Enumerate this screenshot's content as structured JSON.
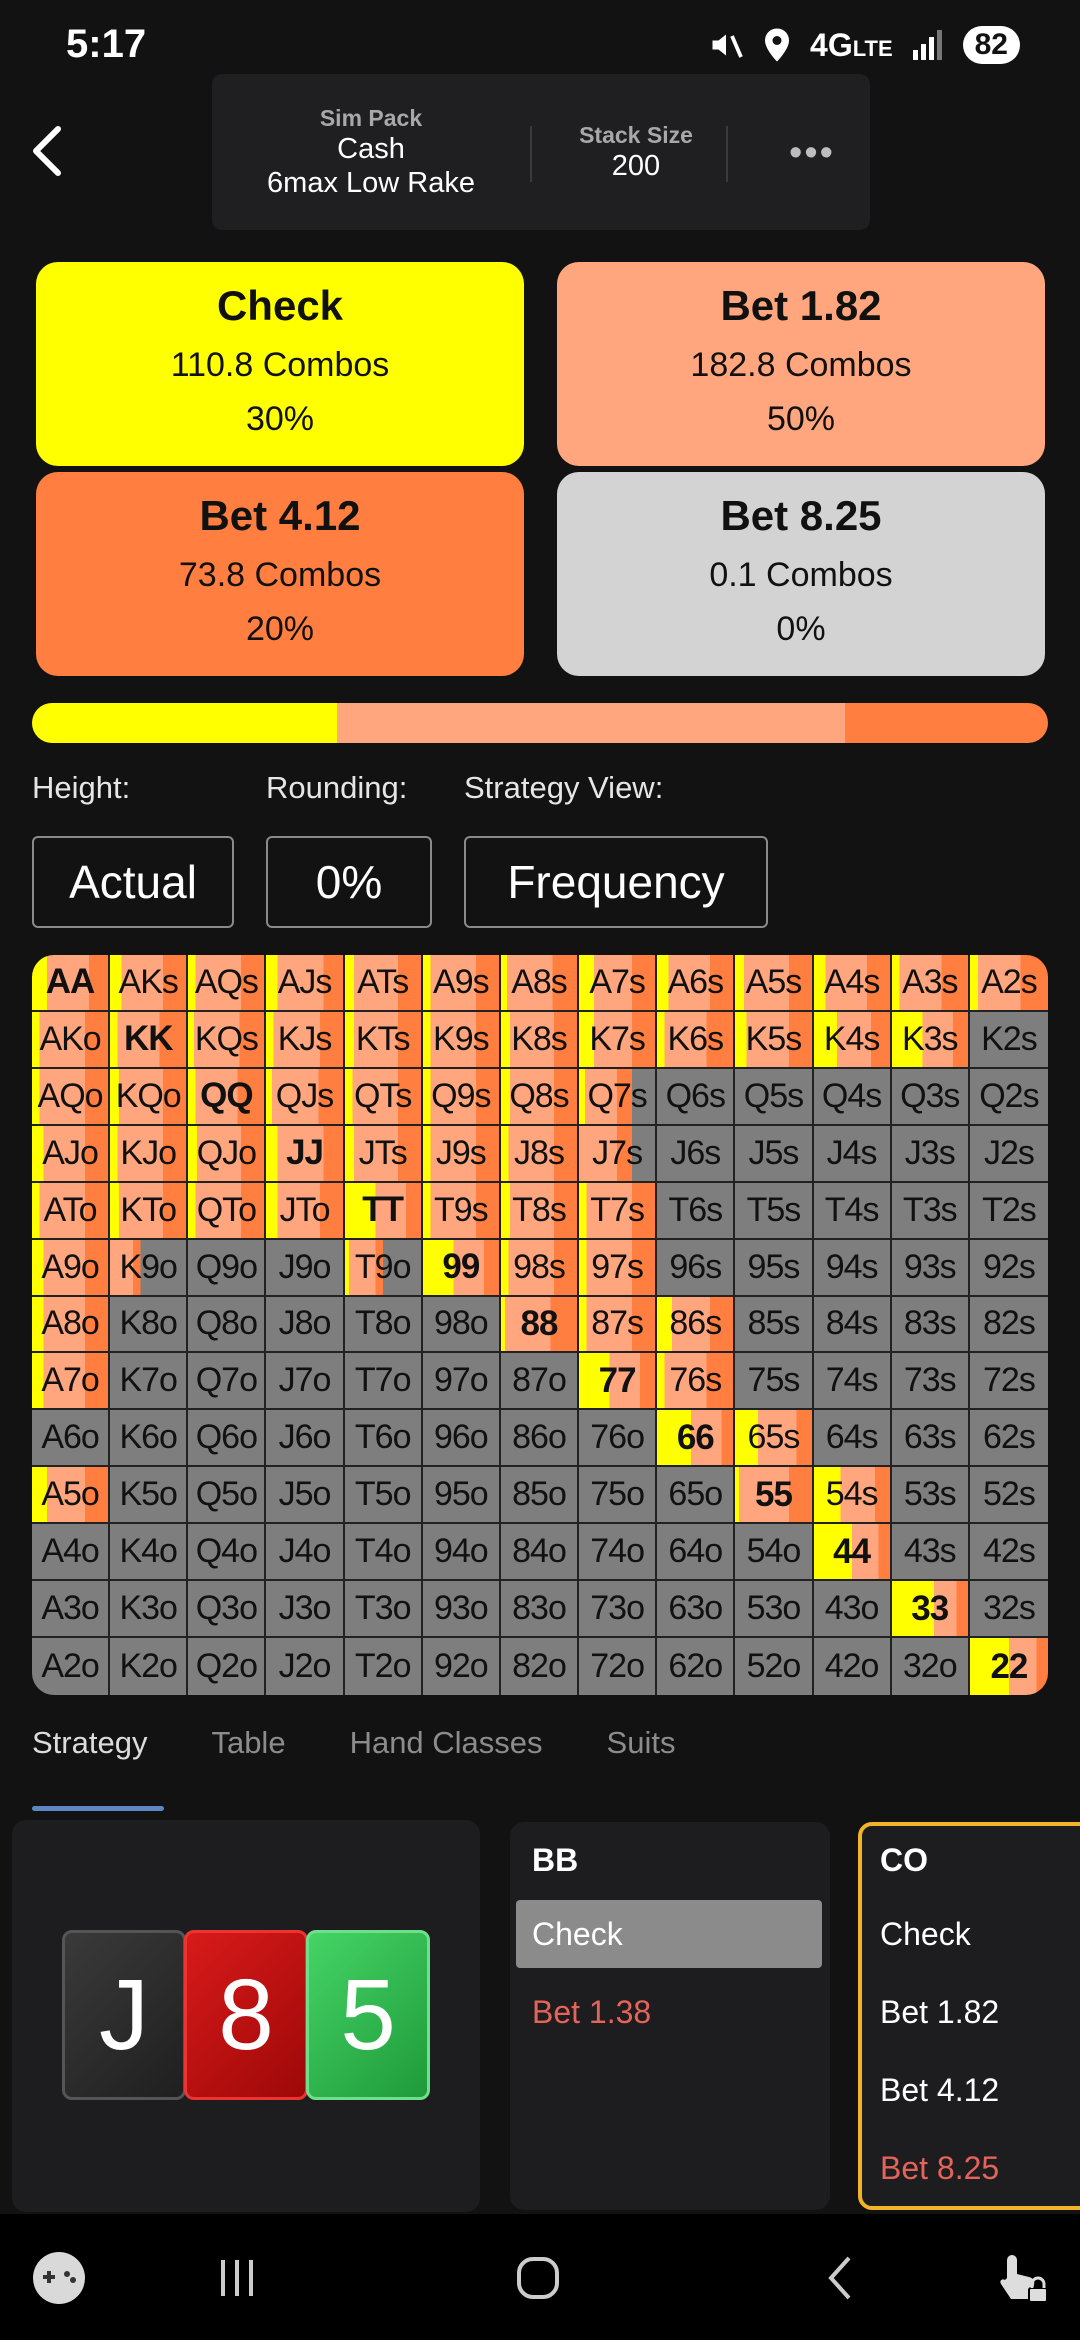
{
  "status": {
    "time": "5:17",
    "network": "4G",
    "lte": "LTE",
    "battery": "82"
  },
  "header": {
    "sim_pack_label": "Sim Pack",
    "sim_pack_line1": "Cash",
    "sim_pack_line2": "6max Low Rake",
    "stack_label": "Stack Size",
    "stack_value": "200",
    "more": "•••"
  },
  "actions": [
    {
      "title": "Check",
      "combos": "110.8 Combos",
      "pct": "30%",
      "color": "#ffff00",
      "share": 0.3
    },
    {
      "title": "Bet 1.82",
      "combos": "182.8 Combos",
      "pct": "50%",
      "color": "#ffa67e",
      "share": 0.5
    },
    {
      "title": "Bet 4.12",
      "combos": "73.8 Combos",
      "pct": "20%",
      "color": "#ff7e40",
      "share": 0.2
    },
    {
      "title": "Bet 8.25",
      "combos": "0.1 Combos",
      "pct": "0%",
      "color": "#d3d3d3",
      "share": 0.0
    }
  ],
  "settings": {
    "height_label": "Height:",
    "height_value": "Actual",
    "rounding_label": "Rounding:",
    "rounding_value": "0%",
    "view_label": "Strategy View:",
    "view_value": "Frequency"
  },
  "grid": {
    "rows": [
      [
        "AA",
        "AKs",
        "AQs",
        "AJs",
        "ATs",
        "A9s",
        "A8s",
        "A7s",
        "A6s",
        "A5s",
        "A4s",
        "A3s",
        "A2s"
      ],
      [
        "AKo",
        "KK",
        "KQs",
        "KJs",
        "KTs",
        "K9s",
        "K8s",
        "K7s",
        "K6s",
        "K5s",
        "K4s",
        "K3s",
        "K2s"
      ],
      [
        "AQo",
        "KQo",
        "QQ",
        "QJs",
        "QTs",
        "Q9s",
        "Q8s",
        "Q7s",
        "Q6s",
        "Q5s",
        "Q4s",
        "Q3s",
        "Q2s"
      ],
      [
        "AJo",
        "KJo",
        "QJo",
        "JJ",
        "JTs",
        "J9s",
        "J8s",
        "J7s",
        "J6s",
        "J5s",
        "J4s",
        "J3s",
        "J2s"
      ],
      [
        "ATo",
        "KTo",
        "QTo",
        "JTo",
        "TT",
        "T9s",
        "T8s",
        "T7s",
        "T6s",
        "T5s",
        "T4s",
        "T3s",
        "T2s"
      ],
      [
        "A9o",
        "K9o",
        "Q9o",
        "J9o",
        "T9o",
        "99",
        "98s",
        "97s",
        "96s",
        "95s",
        "94s",
        "93s",
        "92s"
      ],
      [
        "A8o",
        "K8o",
        "Q8o",
        "J8o",
        "T8o",
        "98o",
        "88",
        "87s",
        "86s",
        "85s",
        "84s",
        "83s",
        "82s"
      ],
      [
        "A7o",
        "K7o",
        "Q7o",
        "J7o",
        "T7o",
        "97o",
        "87o",
        "77",
        "76s",
        "75s",
        "74s",
        "73s",
        "72s"
      ],
      [
        "A6o",
        "K6o",
        "Q6o",
        "J6o",
        "T6o",
        "96o",
        "86o",
        "76o",
        "66",
        "65s",
        "64s",
        "63s",
        "62s"
      ],
      [
        "A5o",
        "K5o",
        "Q5o",
        "J5o",
        "T5o",
        "95o",
        "85o",
        "75o",
        "65o",
        "55",
        "54s",
        "53s",
        "52s"
      ],
      [
        "A4o",
        "K4o",
        "Q4o",
        "J4o",
        "T4o",
        "94o",
        "84o",
        "74o",
        "64o",
        "54o",
        "44",
        "43s",
        "42s"
      ],
      [
        "A3o",
        "K3o",
        "Q3o",
        "J3o",
        "T3o",
        "93o",
        "83o",
        "73o",
        "63o",
        "53o",
        "43o",
        "33",
        "32s"
      ],
      [
        "A2o",
        "K2o",
        "Q2o",
        "J2o",
        "T2o",
        "92o",
        "82o",
        "72o",
        "62o",
        "52o",
        "42o",
        "32o",
        "22"
      ]
    ],
    "frequencies": [
      [
        [
          0.2,
          0.55,
          0.25
        ],
        [
          0.15,
          0.55,
          0.3
        ],
        [
          0.1,
          0.6,
          0.3
        ],
        [
          0.15,
          0.6,
          0.25
        ],
        [
          0.12,
          0.58,
          0.3
        ],
        [
          0.1,
          0.6,
          0.3
        ],
        [
          0.08,
          0.6,
          0.32
        ],
        [
          0.2,
          0.5,
          0.3
        ],
        [
          0.15,
          0.55,
          0.3
        ],
        [
          0.12,
          0.58,
          0.3
        ],
        [
          0.15,
          0.55,
          0.3
        ],
        [
          0.1,
          0.55,
          0.35
        ],
        [
          0.1,
          0.55,
          0.35
        ]
      ],
      [
        [
          0.1,
          0.6,
          0.3
        ],
        [
          0.1,
          0.55,
          0.35
        ],
        [
          0.08,
          0.6,
          0.32
        ],
        [
          0.1,
          0.6,
          0.3
        ],
        [
          0.12,
          0.58,
          0.3
        ],
        [
          0.1,
          0.6,
          0.3
        ],
        [
          0.12,
          0.58,
          0.3
        ],
        [
          0.2,
          0.5,
          0.3
        ],
        [
          0.1,
          0.55,
          0.35
        ],
        [
          0.15,
          0.55,
          0.3
        ],
        [
          0.3,
          0.45,
          0.25
        ],
        [
          0.4,
          0.4,
          0.2
        ],
        [
          0.0,
          0.0,
          0.0
        ]
      ],
      [
        [
          0.1,
          0.6,
          0.3
        ],
        [
          0.12,
          0.58,
          0.3
        ],
        [
          0.1,
          0.55,
          0.35
        ],
        [
          0.08,
          0.6,
          0.32
        ],
        [
          0.1,
          0.6,
          0.3
        ],
        [
          0.1,
          0.6,
          0.3
        ],
        [
          0.12,
          0.58,
          0.3
        ],
        [
          0.08,
          0.42,
          0.2
        ],
        [
          0.0,
          0.0,
          0.0
        ],
        [
          0.0,
          0.0,
          0.0
        ],
        [
          0.0,
          0.0,
          0.0
        ],
        [
          0.0,
          0.0,
          0.0
        ],
        [
          0.0,
          0.0,
          0.0
        ]
      ],
      [
        [
          0.15,
          0.55,
          0.3
        ],
        [
          0.1,
          0.6,
          0.3
        ],
        [
          0.12,
          0.58,
          0.3
        ],
        [
          0.15,
          0.6,
          0.25
        ],
        [
          0.12,
          0.58,
          0.3
        ],
        [
          0.1,
          0.6,
          0.3
        ],
        [
          0.1,
          0.6,
          0.3
        ],
        [
          0.0,
          0.5,
          0.2
        ],
        [
          0.0,
          0.0,
          0.0
        ],
        [
          0.0,
          0.0,
          0.0
        ],
        [
          0.0,
          0.0,
          0.0
        ],
        [
          0.0,
          0.0,
          0.0
        ],
        [
          0.0,
          0.0,
          0.0
        ]
      ],
      [
        [
          0.1,
          0.6,
          0.3
        ],
        [
          0.12,
          0.58,
          0.3
        ],
        [
          0.1,
          0.6,
          0.3
        ],
        [
          0.15,
          0.55,
          0.3
        ],
        [
          0.4,
          0.4,
          0.2
        ],
        [
          0.1,
          0.6,
          0.3
        ],
        [
          0.12,
          0.58,
          0.3
        ],
        [
          0.1,
          0.6,
          0.3
        ],
        [
          0.0,
          0.0,
          0.0
        ],
        [
          0.0,
          0.0,
          0.0
        ],
        [
          0.0,
          0.0,
          0.0
        ],
        [
          0.0,
          0.0,
          0.0
        ],
        [
          0.0,
          0.0,
          0.0
        ]
      ],
      [
        [
          0.15,
          0.55,
          0.3
        ],
        [
          0.0,
          0.3,
          0.1
        ],
        [
          0.0,
          0.0,
          0.0
        ],
        [
          0.0,
          0.0,
          0.0
        ],
        [
          0.05,
          0.35,
          0.1
        ],
        [
          0.4,
          0.4,
          0.2
        ],
        [
          0.1,
          0.6,
          0.3
        ],
        [
          0.1,
          0.6,
          0.3
        ],
        [
          0.0,
          0.0,
          0.0
        ],
        [
          0.0,
          0.0,
          0.0
        ],
        [
          0.0,
          0.0,
          0.0
        ],
        [
          0.0,
          0.0,
          0.0
        ],
        [
          0.0,
          0.0,
          0.0
        ]
      ],
      [
        [
          0.15,
          0.55,
          0.3
        ],
        [
          0.0,
          0.0,
          0.0
        ],
        [
          0.0,
          0.0,
          0.0
        ],
        [
          0.0,
          0.0,
          0.0
        ],
        [
          0.0,
          0.0,
          0.0
        ],
        [
          0.0,
          0.0,
          0.0
        ],
        [
          0.05,
          0.6,
          0.35
        ],
        [
          0.1,
          0.6,
          0.3
        ],
        [
          0.2,
          0.5,
          0.3
        ],
        [
          0.0,
          0.0,
          0.0
        ],
        [
          0.0,
          0.0,
          0.0
        ],
        [
          0.0,
          0.0,
          0.0
        ],
        [
          0.0,
          0.0,
          0.0
        ]
      ],
      [
        [
          0.15,
          0.55,
          0.3
        ],
        [
          0.0,
          0.0,
          0.0
        ],
        [
          0.0,
          0.0,
          0.0
        ],
        [
          0.0,
          0.0,
          0.0
        ],
        [
          0.0,
          0.0,
          0.0
        ],
        [
          0.0,
          0.0,
          0.0
        ],
        [
          0.0,
          0.0,
          0.0
        ],
        [
          0.4,
          0.4,
          0.2
        ],
        [
          0.1,
          0.55,
          0.35
        ],
        [
          0.0,
          0.0,
          0.0
        ],
        [
          0.0,
          0.0,
          0.0
        ],
        [
          0.0,
          0.0,
          0.0
        ],
        [
          0.0,
          0.0,
          0.0
        ]
      ],
      [
        [
          0.0,
          0.0,
          0.0
        ],
        [
          0.0,
          0.0,
          0.0
        ],
        [
          0.0,
          0.0,
          0.0
        ],
        [
          0.0,
          0.0,
          0.0
        ],
        [
          0.0,
          0.0,
          0.0
        ],
        [
          0.0,
          0.0,
          0.0
        ],
        [
          0.0,
          0.0,
          0.0
        ],
        [
          0.0,
          0.0,
          0.0
        ],
        [
          0.45,
          0.4,
          0.15
        ],
        [
          0.3,
          0.5,
          0.2
        ],
        [
          0.0,
          0.0,
          0.0
        ],
        [
          0.0,
          0.0,
          0.0
        ],
        [
          0.0,
          0.0,
          0.0
        ]
      ],
      [
        [
          0.2,
          0.5,
          0.3
        ],
        [
          0.0,
          0.0,
          0.0
        ],
        [
          0.0,
          0.0,
          0.0
        ],
        [
          0.0,
          0.0,
          0.0
        ],
        [
          0.0,
          0.0,
          0.0
        ],
        [
          0.0,
          0.0,
          0.0
        ],
        [
          0.0,
          0.0,
          0.0
        ],
        [
          0.0,
          0.0,
          0.0
        ],
        [
          0.0,
          0.0,
          0.0
        ],
        [
          0.05,
          0.65,
          0.3
        ],
        [
          0.35,
          0.45,
          0.2
        ],
        [
          0.0,
          0.0,
          0.0
        ],
        [
          0.0,
          0.0,
          0.0
        ]
      ],
      [
        [
          0.0,
          0.0,
          0.0
        ],
        [
          0.0,
          0.0,
          0.0
        ],
        [
          0.0,
          0.0,
          0.0
        ],
        [
          0.0,
          0.0,
          0.0
        ],
        [
          0.0,
          0.0,
          0.0
        ],
        [
          0.0,
          0.0,
          0.0
        ],
        [
          0.0,
          0.0,
          0.0
        ],
        [
          0.0,
          0.0,
          0.0
        ],
        [
          0.0,
          0.0,
          0.0
        ],
        [
          0.0,
          0.0,
          0.0
        ],
        [
          0.5,
          0.35,
          0.15
        ],
        [
          0.0,
          0.0,
          0.0
        ],
        [
          0.0,
          0.0,
          0.0
        ]
      ],
      [
        [
          0.0,
          0.0,
          0.0
        ],
        [
          0.0,
          0.0,
          0.0
        ],
        [
          0.0,
          0.0,
          0.0
        ],
        [
          0.0,
          0.0,
          0.0
        ],
        [
          0.0,
          0.0,
          0.0
        ],
        [
          0.0,
          0.0,
          0.0
        ],
        [
          0.0,
          0.0,
          0.0
        ],
        [
          0.0,
          0.0,
          0.0
        ],
        [
          0.0,
          0.0,
          0.0
        ],
        [
          0.0,
          0.0,
          0.0
        ],
        [
          0.0,
          0.0,
          0.0
        ],
        [
          0.55,
          0.3,
          0.15
        ],
        [
          0.0,
          0.0,
          0.0
        ]
      ],
      [
        [
          0.0,
          0.0,
          0.0
        ],
        [
          0.0,
          0.0,
          0.0
        ],
        [
          0.0,
          0.0,
          0.0
        ],
        [
          0.0,
          0.0,
          0.0
        ],
        [
          0.0,
          0.0,
          0.0
        ],
        [
          0.0,
          0.0,
          0.0
        ],
        [
          0.0,
          0.0,
          0.0
        ],
        [
          0.0,
          0.0,
          0.0
        ],
        [
          0.0,
          0.0,
          0.0
        ],
        [
          0.0,
          0.0,
          0.0
        ],
        [
          0.0,
          0.0,
          0.0
        ],
        [
          0.0,
          0.0,
          0.0
        ],
        [
          0.5,
          0.35,
          0.15
        ]
      ]
    ],
    "fold_color": "#7e7e7e"
  },
  "tabs": [
    "Strategy",
    "Table",
    "Hand Classes",
    "Suits"
  ],
  "board": [
    {
      "rank": "J",
      "color": "#2f2f2f"
    },
    {
      "rank": "8",
      "color": "#c40e0e"
    },
    {
      "rank": "5",
      "color": "#2fbf4f"
    }
  ],
  "positions": [
    {
      "name": "BB",
      "actions": [
        {
          "label": "Check",
          "selected": true,
          "color": "#ffffff"
        },
        {
          "label": "Bet 1.38",
          "selected": false,
          "color": "#e5635a"
        }
      ]
    },
    {
      "name": "CO",
      "actions": [
        {
          "label": "Check",
          "selected": false,
          "color": "#ffffff"
        },
        {
          "label": "Bet 1.82",
          "selected": false,
          "color": "#ffffff"
        },
        {
          "label": "Bet 4.12",
          "selected": false,
          "color": "#ffffff"
        },
        {
          "label": "Bet 8.25",
          "selected": false,
          "color": "#e5635a"
        }
      ]
    }
  ]
}
